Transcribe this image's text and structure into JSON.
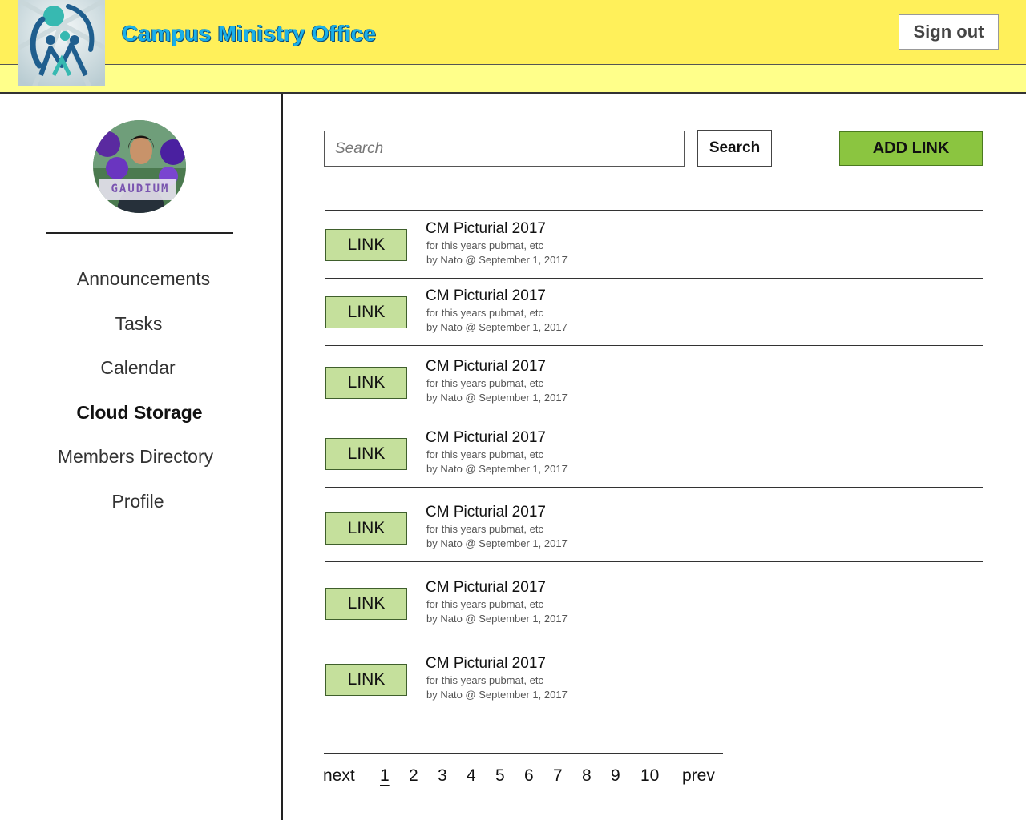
{
  "header": {
    "title": "Campus Ministry Office",
    "sign_out_label": "Sign out",
    "logo_icon": "campus-ministry-logo",
    "colors": {
      "header_bg": "#fff05a",
      "band_bg": "#ffff8a",
      "title": "#1bb0e8"
    }
  },
  "sidebar": {
    "avatar_caption": "GAUDIUM",
    "items": [
      {
        "label": "Announcements",
        "active": false
      },
      {
        "label": "Tasks",
        "active": false
      },
      {
        "label": "Calendar",
        "active": false
      },
      {
        "label": "Cloud Storage",
        "active": true
      },
      {
        "label": "Members Directory",
        "active": false
      },
      {
        "label": "Profile",
        "active": false
      }
    ]
  },
  "main": {
    "search": {
      "placeholder": "Search",
      "value": "",
      "button_label": "Search"
    },
    "add_link_label": "ADD LINK",
    "colors": {
      "add_button": "#8bc540",
      "link_button": "#c5e09c"
    },
    "links": [
      {
        "button_label": "LINK",
        "title": "CM Picturial 2017",
        "description": "for this years pubmat, etc",
        "meta": "by Nato @ September 1, 2017"
      },
      {
        "button_label": "LINK",
        "title": "CM Picturial 2017",
        "description": "for this years pubmat, etc",
        "meta": "by Nato @ September 1, 2017"
      },
      {
        "button_label": "LINK",
        "title": "CM Picturial 2017",
        "description": "for this years pubmat, etc",
        "meta": "by Nato @ September 1, 2017"
      },
      {
        "button_label": "LINK",
        "title": "CM Picturial 2017",
        "description": "for this years pubmat, etc",
        "meta": "by Nato @ September 1, 2017"
      },
      {
        "button_label": "LINK",
        "title": "CM Picturial 2017",
        "description": "for this years pubmat, etc",
        "meta": "by Nato @ September 1, 2017"
      },
      {
        "button_label": "LINK",
        "title": "CM Picturial 2017",
        "description": "for this years pubmat, etc",
        "meta": "by Nato @ September 1, 2017"
      },
      {
        "button_label": "LINK",
        "title": "CM Picturial 2017",
        "description": "for this years pubmat, etc",
        "meta": "by Nato @ September 1, 2017"
      }
    ],
    "pagination": {
      "next_label": "next",
      "prev_label": "prev",
      "pages": [
        "1",
        "2",
        "3",
        "4",
        "5",
        "6",
        "7",
        "8",
        "9",
        "10"
      ],
      "current_page": "1"
    }
  }
}
